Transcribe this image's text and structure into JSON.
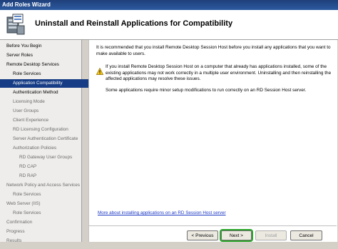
{
  "window": {
    "title": "Add Roles Wizard"
  },
  "header": {
    "title": "Uninstall and Reinstall Applications for Compatibility",
    "icon": "server-roles-icon"
  },
  "nav": {
    "items": [
      {
        "label": "Before You Begin",
        "state": "normal"
      },
      {
        "label": "Server Roles",
        "state": "normal"
      },
      {
        "label": "Remote Desktop Services",
        "state": "normal"
      },
      {
        "label": "Role Services",
        "state": "normal"
      },
      {
        "label": "Application Compatibility",
        "state": "active"
      },
      {
        "label": "Authentication Method",
        "state": "normal"
      },
      {
        "label": "Licensing Mode",
        "state": "dim"
      },
      {
        "label": "User Groups",
        "state": "dim"
      },
      {
        "label": "Client Experience",
        "state": "dim"
      },
      {
        "label": "RD Licensing Configuration",
        "state": "dim"
      },
      {
        "label": "Server Authentication Certificate",
        "state": "dim"
      },
      {
        "label": "Authorization Policies",
        "state": "dim"
      },
      {
        "label": "RD Gateway User Groups",
        "state": "dim"
      },
      {
        "label": "RD CAP",
        "state": "dim"
      },
      {
        "label": "RD RAP",
        "state": "dim"
      },
      {
        "label": "Network Policy and Access Services",
        "state": "dim"
      },
      {
        "label": "Role Services",
        "state": "dim"
      },
      {
        "label": "Web Server (IIS)",
        "state": "dim"
      },
      {
        "label": "Role Services",
        "state": "dim"
      },
      {
        "label": "Confirmation",
        "state": "dim"
      },
      {
        "label": "Progress",
        "state": "dim"
      },
      {
        "label": "Results",
        "state": "dim"
      }
    ]
  },
  "content": {
    "intro": "It is recommended that you install Remote Desktop Session Host before you install any applications that you want to make available to users.",
    "warning": "If you install Remote Desktop Session Host on a computer that already has applications installed, some of the existing applications may not work correctly in a multiple user environment. Uninstalling and then reinstalling the affected applications may resolve these issues.",
    "note": "Some applications require minor setup modifications to run correctly on an RD Session Host server.",
    "link": "More about installing applications on an RD Session Host server"
  },
  "buttons": {
    "previous": "< Previous",
    "next": "Next >",
    "install": "Install",
    "cancel": "Cancel"
  },
  "colors": {
    "title_bar": "#2c5aa0",
    "nav_active": "#163c85",
    "link": "#1d39c4",
    "focus_ring": "#2aa62a"
  }
}
